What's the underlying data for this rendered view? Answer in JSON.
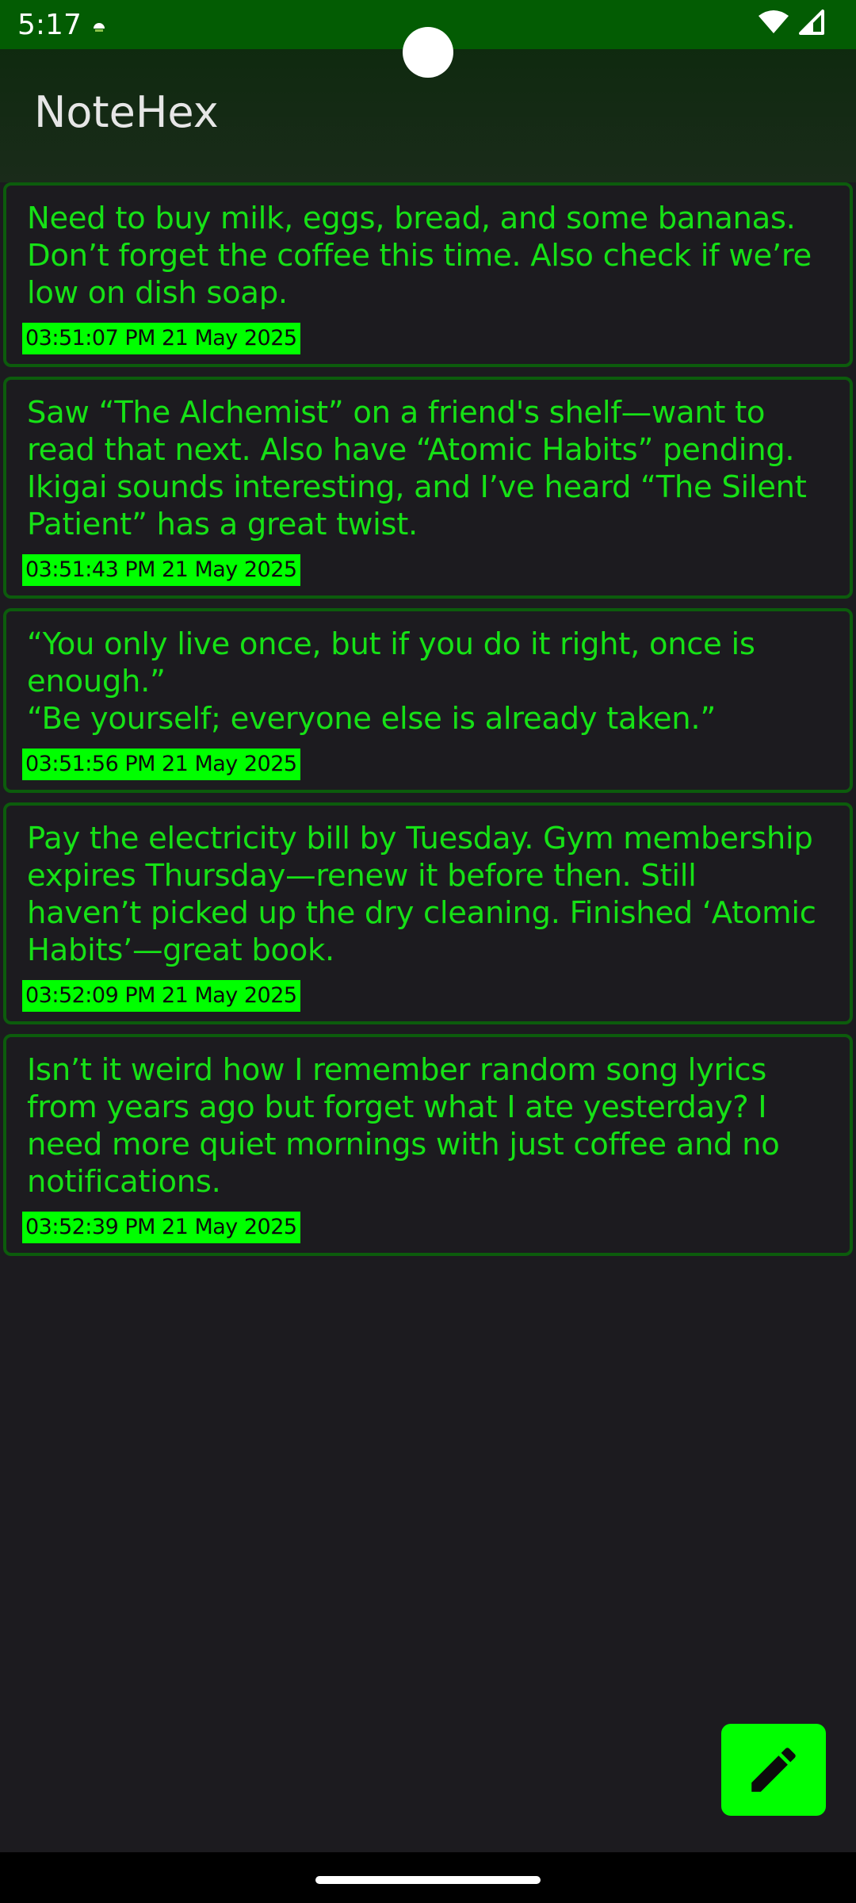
{
  "status_bar": {
    "time": "5:17",
    "icons": [
      "notification-icon",
      "wifi-icon",
      "signal-icon"
    ]
  },
  "app": {
    "title": "NoteHex"
  },
  "notes": [
    {
      "text": "Need to buy milk, eggs, bread, and some bananas.\nDon’t forget the coffee this time. Also check if we’re\nlow on dish soap.",
      "timestamp": "03:51:07 PM 21 May 2025"
    },
    {
      "text": "Saw “The Alchemist” on a friend's shelf—want to\nread that next. Also have “Atomic Habits” pending.\nIkigai sounds interesting, and I’ve heard “The Silent\nPatient” has a great twist.",
      "timestamp": "03:51:43 PM 21 May 2025"
    },
    {
      "text": "“You only live once, but if you do it right, once is\nenough.”\n“Be yourself; everyone else is already taken.”",
      "timestamp": "03:51:56 PM 21 May 2025"
    },
    {
      "text": "Pay the electricity bill by Tuesday. Gym membership\nexpires Thursday—renew it before then. Still\nhaven’t picked up the dry cleaning. Finished ‘Atomic\nHabits’—great book.",
      "timestamp": "03:52:09 PM 21 May 2025"
    },
    {
      "text": "Isn’t it weird how I remember random song lyrics\nfrom years ago but forget what I ate yesterday? I\nneed more quiet mornings with just coffee and no\nnotifications.",
      "timestamp": "03:52:39 PM 21 May 2025"
    }
  ],
  "fab": {
    "icon": "edit-pencil-icon"
  },
  "colors": {
    "status_bar": "#035c03",
    "background": "#1c1b1f",
    "accent_green": "#00ff00",
    "note_text": "#16e116",
    "card_border": "#0c5c0c"
  }
}
